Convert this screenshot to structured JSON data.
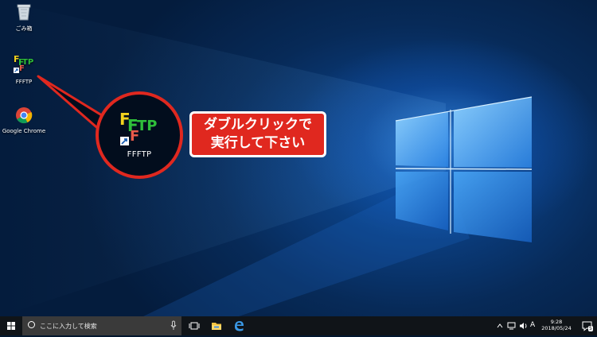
{
  "desktop": {
    "icons": [
      {
        "label": "ごみ箱",
        "icon": "recycle-bin-icon"
      },
      {
        "label": "FFFTP",
        "icon": "ffftp-icon"
      },
      {
        "label": "Google Chrome",
        "icon": "chrome-icon"
      }
    ]
  },
  "callout": {
    "icon_label": "FFFTP",
    "note_line1": "ダブルクリックで",
    "note_line2": "実行して下さい"
  },
  "taskbar": {
    "search_placeholder": "ここに入力して検索",
    "ime_indicator": "A",
    "clock_time": "9:28",
    "clock_date": "2018/05/24",
    "notification_count": "5"
  },
  "colors": {
    "callout_red": "#e0281f",
    "taskbar": "#101418",
    "wallpaper_blue": "#0a3a78"
  }
}
